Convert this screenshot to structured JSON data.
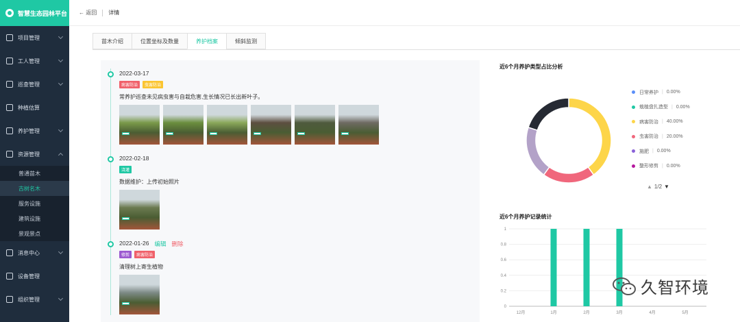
{
  "app": {
    "title": "智慧生态园林平台"
  },
  "sidebar": {
    "items": [
      {
        "label": "项目管理",
        "icon": "folder-icon"
      },
      {
        "label": "工人管理",
        "icon": "user-icon"
      },
      {
        "label": "巡查管理",
        "icon": "inspect-icon"
      },
      {
        "label": "种植估算",
        "icon": "calc-icon"
      },
      {
        "label": "养护管理",
        "icon": "care-icon"
      },
      {
        "label": "资源管理",
        "icon": "resource-icon"
      }
    ],
    "submenu": [
      "普通苗木",
      "古树名木",
      "服务设施",
      "建筑设施",
      "景观景点"
    ],
    "active_sub": "古树名木",
    "bottom_items": [
      {
        "label": "消息中心",
        "icon": "bell-icon"
      },
      {
        "label": "设备管理",
        "icon": "device-icon"
      },
      {
        "label": "组织管理",
        "icon": "org-icon"
      }
    ]
  },
  "topbar": {
    "back": "← 返回",
    "title": "详情"
  },
  "tabs": [
    "苗木介绍",
    "位置坐标及数量",
    "养护档案",
    "倾斜监测"
  ],
  "active_tab": "养护档案",
  "timeline": [
    {
      "date": "2022-03-17",
      "tags": [
        {
          "label": "病害防治",
          "color": "#f0616a"
        },
        {
          "label": "虫害防治",
          "color": "#fbc531"
        }
      ],
      "desc": "常养护巡查未见病虫害与自栽危害,生长情况已长出新叶子。",
      "photos": 6
    },
    {
      "date": "2022-02-18",
      "tags": [
        {
          "label": "浇灌",
          "color": "#1fc8a4"
        }
      ],
      "desc": "数据维护：上传初始照片",
      "photos": 1
    },
    {
      "date": "2022-01-26",
      "edit": "编辑",
      "delete": "删除",
      "tags": [
        {
          "label": "修剪",
          "color": "#9b59d0"
        },
        {
          "label": "病害防治",
          "color": "#f0616a"
        }
      ],
      "desc": "清理树上寄生植物",
      "photos": 1
    }
  ],
  "pie_title": "近6个月养护类型占比分析",
  "bar_title": "近6个月养护记录统计",
  "legend": [
    {
      "label": "日常养护",
      "value": "0.00%",
      "color": "#5b8ff9"
    },
    {
      "label": "栽植盘扎造型",
      "value": "0.00%",
      "color": "#1fc8a4"
    },
    {
      "label": "病害防治",
      "value": "40.00%",
      "color": "#fdd549"
    },
    {
      "label": "虫害防治",
      "value": "20.00%",
      "color": "#f0677c"
    },
    {
      "label": "施肥",
      "value": "0.00%",
      "color": "#8a62d8"
    },
    {
      "label": "整形修剪",
      "value": "0.00%",
      "color": "#b5179e"
    }
  ],
  "pager": "1/2",
  "chart_data": [
    {
      "type": "pie",
      "title": "近6个月养护类型占比分析",
      "slices": [
        {
          "label": "病害防治",
          "value": 40,
          "color": "#fdd549"
        },
        {
          "label": "虫害防治",
          "value": 20,
          "color": "#f0677c"
        },
        {
          "label": "",
          "value": 20,
          "color": "#b3a2c8"
        },
        {
          "label": "",
          "value": 20,
          "color": "#262a33"
        }
      ]
    },
    {
      "type": "bar",
      "title": "近6个月养护记录统计",
      "categories": [
        "12月",
        "1月",
        "2月",
        "3月",
        "4月",
        "5月"
      ],
      "values": [
        0,
        1,
        1,
        1,
        0,
        0
      ],
      "ylim": [
        0,
        1
      ],
      "yticks": [
        "0",
        "0.2",
        "0.4",
        "0.6",
        "0.8",
        "1"
      ],
      "bar_color": "#1fc8a4"
    }
  ],
  "watermark": "久智环境"
}
